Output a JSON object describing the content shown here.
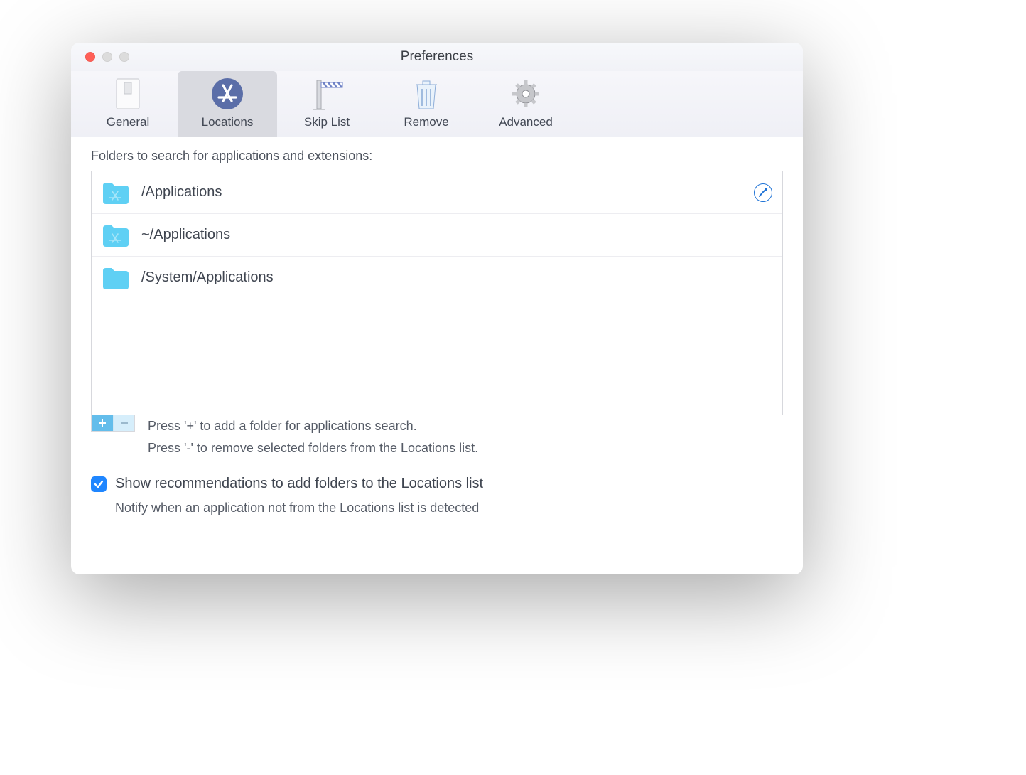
{
  "window": {
    "title": "Preferences"
  },
  "toolbar": {
    "tabs": [
      {
        "label": "General",
        "icon": "switch-icon"
      },
      {
        "label": "Locations",
        "icon": "app-store-icon"
      },
      {
        "label": "Skip List",
        "icon": "barrier-icon"
      },
      {
        "label": "Remove",
        "icon": "trash-icon"
      },
      {
        "label": "Advanced",
        "icon": "gear-icon"
      }
    ],
    "active_index": 1
  },
  "locations": {
    "section_label": "Folders to search for applications and extensions:",
    "folders": [
      {
        "path": "/Applications",
        "icon": "folder-apps-icon",
        "has_action": true
      },
      {
        "path": "~/Applications",
        "icon": "folder-apps-icon",
        "has_action": false
      },
      {
        "path": "/System/Applications",
        "icon": "folder-icon",
        "has_action": false
      }
    ],
    "hint_add": "Press '+' to add a folder for applications search.",
    "hint_remove": "Press '-'  to remove selected folders from the Locations list.",
    "checkbox": {
      "checked": true,
      "label": "Show recommendations to add folders to the Locations list",
      "sublabel": "Notify when an application not from the Locations list is detected"
    }
  }
}
